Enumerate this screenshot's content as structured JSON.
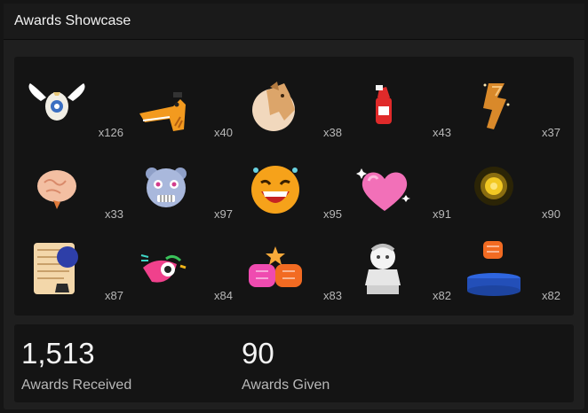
{
  "header": {
    "title": "Awards Showcase"
  },
  "awards": [
    {
      "icon": "winged-egg-icon",
      "count": "x126"
    },
    {
      "icon": "dino-head-icon",
      "count": "x40"
    },
    {
      "icon": "horse-head-icon",
      "count": "x38"
    },
    {
      "icon": "hot-sauce-icon",
      "count": "x43"
    },
    {
      "icon": "golden-rune-icon",
      "count": "x37"
    },
    {
      "icon": "brain-icon",
      "count": "x33"
    },
    {
      "icon": "leopard-face-icon",
      "count": "x97"
    },
    {
      "icon": "laughing-face-icon",
      "count": "x95"
    },
    {
      "icon": "pink-heart-icon",
      "count": "x91"
    },
    {
      "icon": "gold-coin-icon",
      "count": "x90"
    },
    {
      "icon": "scroll-ink-icon",
      "count": "x87"
    },
    {
      "icon": "pink-creature-icon",
      "count": "x84"
    },
    {
      "icon": "boxing-gloves-icon",
      "count": "x83"
    },
    {
      "icon": "marble-bust-icon",
      "count": "x82"
    },
    {
      "icon": "blue-pedestal-fist-icon",
      "count": "x82"
    }
  ],
  "stats": {
    "received": {
      "value": "1,513",
      "label": "Awards Received"
    },
    "given": {
      "value": "90",
      "label": "Awards Given"
    }
  }
}
